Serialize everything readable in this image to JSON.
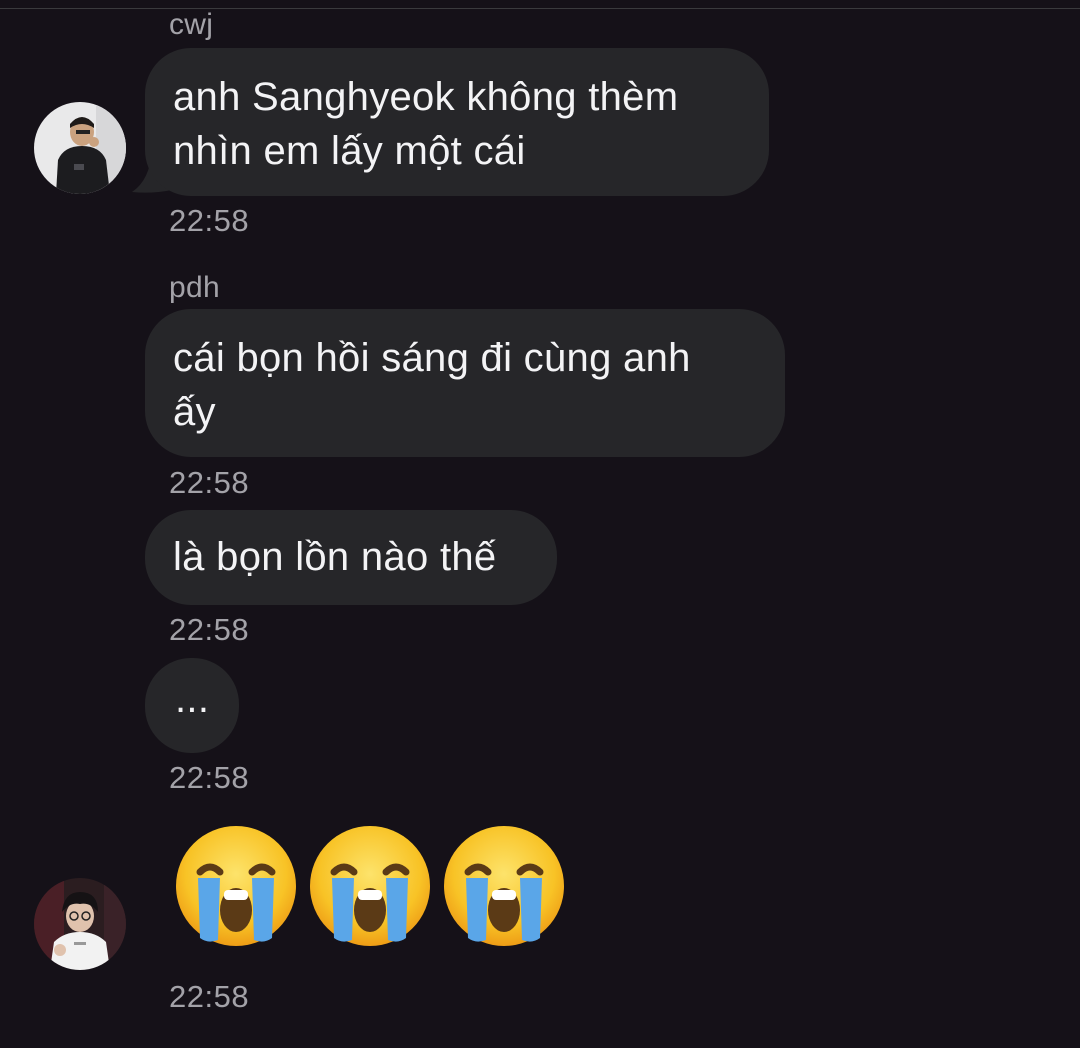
{
  "messages": [
    {
      "sender": "cwj",
      "text": "anh Sanghyeok không thèm\nnhìn em lấy một cái",
      "time": "22:58"
    },
    {
      "sender": "pdh",
      "text": "cái bọn hồi sáng đi cùng anh\nấy",
      "time": "22:58"
    },
    {
      "text": "là bọn lồn nào thế",
      "time": "22:58"
    },
    {
      "text": "...",
      "time": "22:58"
    },
    {
      "emoji": [
        "loudly-crying-face",
        "loudly-crying-face",
        "loudly-crying-face"
      ],
      "time": "22:58"
    }
  ],
  "colors": {
    "background": "#151118",
    "bubble": "#262629",
    "text": "#f3f3f5",
    "meta": "#a3a2a8",
    "emoji_face": "#f8c326",
    "emoji_tears": "#5aa6e8"
  },
  "icons": {
    "avatar_1": "user-avatar-photo",
    "avatar_2": "user-avatar-photo",
    "emoji": "loudly-crying-face"
  }
}
